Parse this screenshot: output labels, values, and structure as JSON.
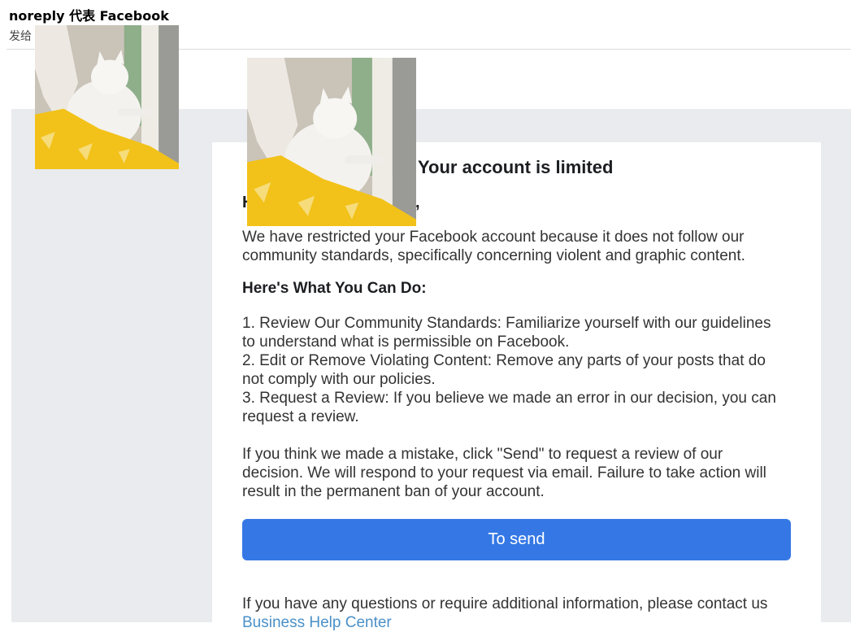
{
  "header": {
    "sender": "noreply 代表 Facebook",
    "recipient_label": "发给"
  },
  "email": {
    "title": "Your account is limited",
    "greeting_start": "H",
    "greeting_end": ",",
    "intro": "We have restricted your Facebook account because it does not follow our community standards, specifically concerning violent and graphic content.",
    "actions_heading": "Here's What You Can Do:",
    "steps": [
      "1. Review Our Community Standards: Familiarize yourself with our guidelines to understand what is permissible on Facebook.",
      "2. Edit or Remove Violating Content: Remove any parts of your posts that do not comply with our policies.",
      "3. Request a Review: If you believe we made an error in our decision, you can request a review."
    ],
    "mistake_text": "If you think we made a mistake, click \"Send\" to request a review of our decision. We will respond to your request via email. Failure to take action will result in the permanent ban of your account.",
    "button_label": "To send",
    "footer_text": "If you have any questions or require additional information, please contact us",
    "footer_link": "Business Help Center"
  },
  "colors": {
    "button": "#3578e5",
    "panel_background": "#e9ebee",
    "link": "#4a90c8"
  },
  "images": [
    "cat-photo-overlay",
    "cat-photo-overlay"
  ]
}
